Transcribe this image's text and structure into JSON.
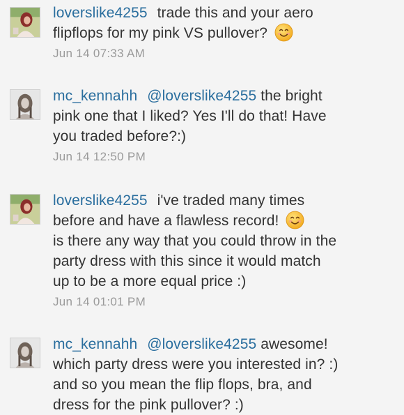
{
  "comments": [
    {
      "username": "loverslike4255",
      "lines": [
        "trade this and your aero",
        "flipflops for my pink VS pullover?"
      ],
      "emoji": "smiling-face-icon",
      "timestamp": "Jun 14 07:33 AM"
    },
    {
      "username": "mc_kennahh",
      "mention": "@loverslike4255",
      "lines": [
        "the bright",
        "pink one that I liked?  Yes I'll do that!  Have",
        "you traded before?:)"
      ],
      "timestamp": "Jun 14 12:50 PM"
    },
    {
      "username": "loverslike4255",
      "lines": [
        "i've traded many times",
        "before and have a flawless record!",
        "is there any way that you could throw in the",
        "party dress with this since it would match",
        "up to be a more equal price :)"
      ],
      "emoji": "smiling-face-icon",
      "timestamp": "Jun 14 01:01 PM"
    },
    {
      "username": "mc_kennahh",
      "mention": "@loverslike4255",
      "lines": [
        "awesome!",
        "which party dress were you interested in? :)",
        "and so you mean the flip flops, bra, and",
        "dress for the pink pullover? :)"
      ]
    }
  ],
  "colors": {
    "username": "#2a6e9e",
    "text": "#333333",
    "timestamp": "#9a9a9a",
    "background": "#f4f4f4"
  }
}
